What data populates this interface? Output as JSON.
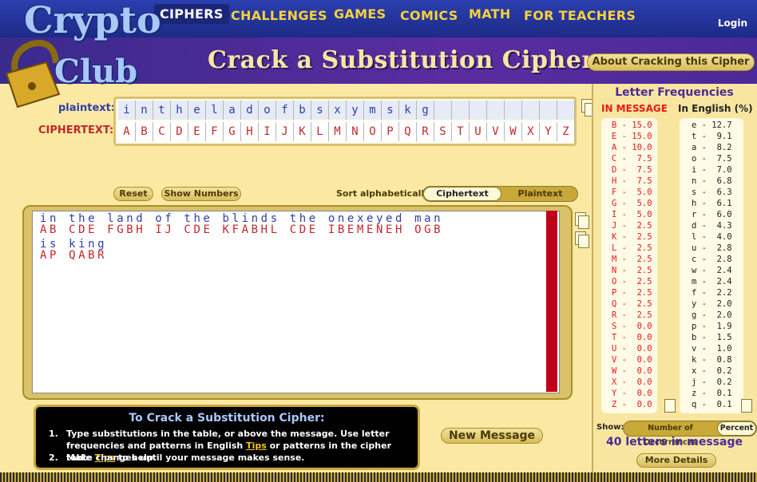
{
  "nav": {
    "items": [
      "CIPHERS",
      "CHALLENGES",
      "GAMES",
      "COMICS",
      "MATH",
      "FOR TEACHERS"
    ],
    "login": "Login"
  },
  "logo": {
    "line1": "Crypto",
    "line2": "Club"
  },
  "page_title": "Crack a Substitution Cipher",
  "about_button": "About Cracking this Cipher",
  "table": {
    "plain_label": "plaintext:",
    "cipher_label": "CIPHERTEXT:",
    "plaintext": [
      "i",
      "n",
      "t",
      "h",
      "e",
      "l",
      "a",
      "d",
      "o",
      "f",
      "b",
      "s",
      "x",
      "y",
      "m",
      "s",
      "k",
      "g",
      "",
      "",
      "",
      "",
      "",
      "",
      "",
      ""
    ],
    "ciphertext": [
      "A",
      "B",
      "C",
      "D",
      "E",
      "F",
      "G",
      "H",
      "I",
      "J",
      "K",
      "L",
      "M",
      "N",
      "O",
      "P",
      "Q",
      "R",
      "S",
      "T",
      "U",
      "V",
      "W",
      "X",
      "Y",
      "Z"
    ]
  },
  "controls": {
    "reset": "Reset",
    "show_numbers": "Show Numbers",
    "sort_label": "Sort alphabetically:",
    "sort_cipher": "Ciphertext",
    "sort_plain": "Plaintext"
  },
  "message": {
    "line1_plain": "in the land of the blinds the onexeyed man",
    "line1_cipher": "AB CDE FGBH IJ CDE KFABHL CDE IBEMENEH OGB",
    "line2_plain": "is king",
    "line2_cipher": "AP QABR"
  },
  "instructions": {
    "title": "To Crack a Substitution Cipher:",
    "n1": "1.",
    "step1_part1": "Type substitutions in the table, or above the message. Use letter frequencies and patterns in English ",
    "tips1": "Tips",
    "step1_part2": " or patterns in the cipher table ",
    "tips2": "Tips",
    "step1_part3": " to help.",
    "n2": "2.",
    "step2": "Make changes until your message makes sense."
  },
  "new_message": "New Message",
  "frequencies": {
    "title": "Letter Frequencies",
    "in_message": "IN MESSAGE",
    "in_english": "In English (%)",
    "message_rows": [
      "B - 15.0",
      "E - 15.0",
      "A - 10.0",
      "C -  7.5",
      "D -  7.5",
      "H -  7.5",
      "F -  5.0",
      "G -  5.0",
      "I -  5.0",
      "J -  2.5",
      "K -  2.5",
      "L -  2.5",
      "M -  2.5",
      "N -  2.5",
      "O -  2.5",
      "P -  2.5",
      "Q -  2.5",
      "R -  2.5",
      "S -  0.0",
      "T -  0.0",
      "U -  0.0",
      "V -  0.0",
      "W -  0.0",
      "X -  0.0",
      "Y -  0.0",
      "Z -  0.0"
    ],
    "english_rows": [
      "e - 12.7",
      "t -  9.1",
      "a -  8.2",
      "o -  7.5",
      "i -  7.0",
      "n -  6.8",
      "s -  6.3",
      "h -  6.1",
      "r -  6.0",
      "d -  4.3",
      "l -  4.0",
      "u -  2.8",
      "c -  2.8",
      "w -  2.4",
      "m -  2.4",
      "f -  2.2",
      "y -  2.0",
      "g -  2.0",
      "p -  1.9",
      "b -  1.5",
      "v -  1.0",
      "k -  0.8",
      "x -  0.2",
      "j -  0.2",
      "z -  0.1",
      "q -  0.1"
    ],
    "show_label": "Show:",
    "show_number": "Number of Occurrences",
    "show_percent": "Percent",
    "letter_count": "40 letters in message",
    "more_details": "More Details"
  },
  "colors": {
    "plain": "#2d3ea8",
    "cipher": "#c0282c",
    "nav_bg": "#2a3fb0",
    "banner": "#5a2ca0",
    "accent_gold": "#c8a838"
  }
}
